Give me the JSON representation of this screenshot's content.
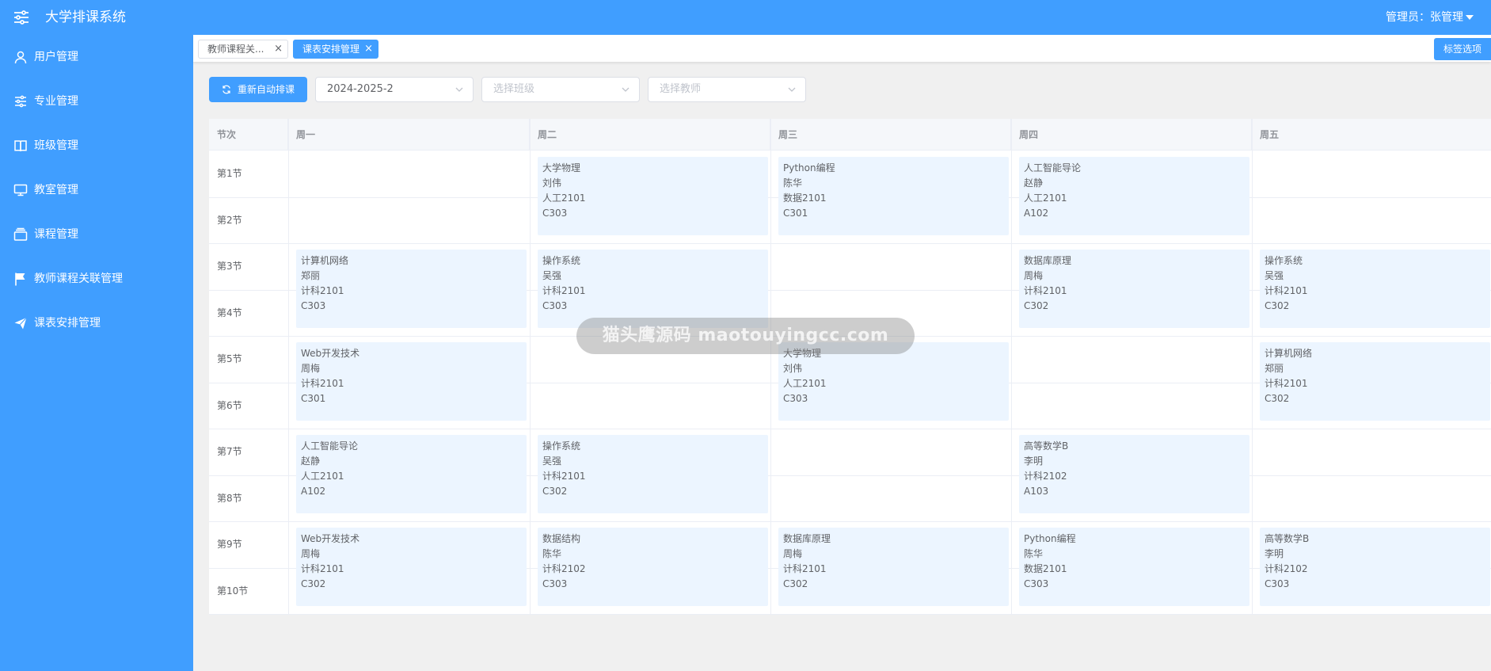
{
  "header": {
    "menu_icon": "sliders-icon",
    "app_title": "大学排课系统",
    "user_label": "管理员：张管理"
  },
  "sidebar": {
    "items": [
      {
        "label": "用户管理",
        "icon": "user-icon"
      },
      {
        "label": "专业管理",
        "icon": "sliders-icon"
      },
      {
        "label": "班级管理",
        "icon": "book-icon"
      },
      {
        "label": "教室管理",
        "icon": "monitor-icon"
      },
      {
        "label": "课程管理",
        "icon": "box-icon"
      },
      {
        "label": "教师课程关联管理",
        "icon": "flag-icon"
      },
      {
        "label": "课表安排管理",
        "icon": "send-icon"
      }
    ]
  },
  "tabs": {
    "items": [
      {
        "label": "教师课程关...",
        "active": false
      },
      {
        "label": "课表安排管理",
        "active": true
      }
    ],
    "close_glyph": "×",
    "options_label": "标签选项"
  },
  "toolbar": {
    "reschedule_label": "重新自动排课",
    "semester_value": "2024-2025-2",
    "class_placeholder": "选择班级",
    "teacher_placeholder": "选择教师"
  },
  "timetable": {
    "headers": [
      "节次",
      "周一",
      "周二",
      "周三",
      "周四",
      "周五"
    ],
    "periods": [
      "第1节",
      "第2节",
      "第3节",
      "第4节",
      "第5节",
      "第6节",
      "第7节",
      "第8节",
      "第9节",
      "第10节"
    ],
    "slots": [
      [
        null,
        {
          "course": "大学物理",
          "teacher": "刘伟",
          "class": "人工2101",
          "room": "C303"
        },
        {
          "course": "Python编程",
          "teacher": "陈华",
          "class": "数据2101",
          "room": "C301"
        },
        {
          "course": "人工智能导论",
          "teacher": "赵静",
          "class": "人工2101",
          "room": "A102"
        },
        null
      ],
      [
        {
          "course": "计算机网络",
          "teacher": "郑丽",
          "class": "计科2101",
          "room": "C303"
        },
        {
          "course": "操作系统",
          "teacher": "吴强",
          "class": "计科2101",
          "room": "C303"
        },
        null,
        {
          "course": "数据库原理",
          "teacher": "周梅",
          "class": "计科2101",
          "room": "C302"
        },
        {
          "course": "操作系统",
          "teacher": "吴强",
          "class": "计科2101",
          "room": "C302"
        }
      ],
      [
        {
          "course": "Web开发技术",
          "teacher": "周梅",
          "class": "计科2101",
          "room": "C301"
        },
        null,
        {
          "course": "大学物理",
          "teacher": "刘伟",
          "class": "人工2101",
          "room": "C303"
        },
        null,
        {
          "course": "计算机网络",
          "teacher": "郑丽",
          "class": "计科2101",
          "room": "C302"
        }
      ],
      [
        {
          "course": "人工智能导论",
          "teacher": "赵静",
          "class": "人工2101",
          "room": "A102"
        },
        {
          "course": "操作系统",
          "teacher": "吴强",
          "class": "计科2101",
          "room": "C302"
        },
        null,
        {
          "course": "高等数学B",
          "teacher": "李明",
          "class": "计科2102",
          "room": "A103"
        },
        null
      ],
      [
        {
          "course": "Web开发技术",
          "teacher": "周梅",
          "class": "计科2101",
          "room": "C302"
        },
        {
          "course": "数据结构",
          "teacher": "陈华",
          "class": "计科2102",
          "room": "C303"
        },
        {
          "course": "数据库原理",
          "teacher": "周梅",
          "class": "计科2101",
          "room": "C302"
        },
        {
          "course": "Python编程",
          "teacher": "陈华",
          "class": "数据2101",
          "room": "C303"
        },
        {
          "course": "高等数学B",
          "teacher": "李明",
          "class": "计科2102",
          "room": "C303"
        }
      ]
    ]
  },
  "watermark": "猫头鹰源码 maotouyingcc.com",
  "colors": {
    "primary": "#409eff",
    "cell_bg": "#ecf5ff",
    "header_bg": "#f5f7fa",
    "border": "#ebeef5"
  }
}
